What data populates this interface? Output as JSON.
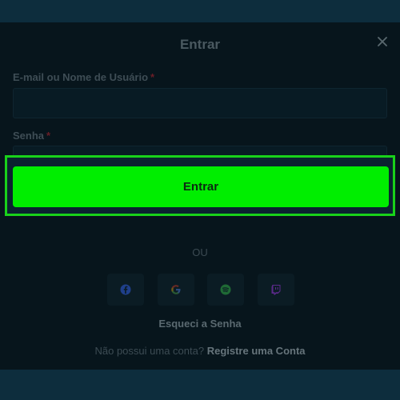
{
  "modal": {
    "title": "Entrar",
    "close_icon": "close-icon"
  },
  "form": {
    "email_label": "E-mail ou Nome de Usuário",
    "email_value": "",
    "password_label": "Senha",
    "password_value": "",
    "required_mark": "*",
    "password_toggle_icon": "eye-icon",
    "submit_label": "Entrar"
  },
  "divider": "OU",
  "social": [
    {
      "name": "facebook-icon",
      "color": "#1f3f8a"
    },
    {
      "name": "google-icon",
      "color": "#3a3a3a"
    },
    {
      "name": "spotify-icon",
      "color": "#1f6a35"
    },
    {
      "name": "twitch-icon",
      "color": "#5b2a8a"
    }
  ],
  "links": {
    "forgot_password": "Esqueci a Senha",
    "no_account": "Não possui uma conta?",
    "register": "Registre uma Conta"
  },
  "colors": {
    "accent_green": "#00ee00",
    "highlight_border": "#19d21a",
    "required_red": "#6a1e27"
  }
}
